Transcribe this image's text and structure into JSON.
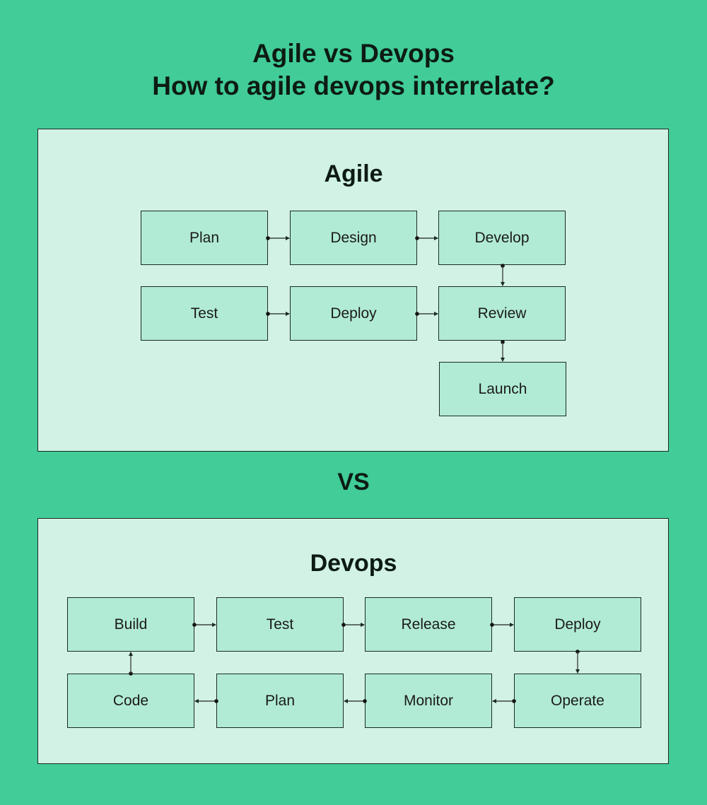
{
  "header": {
    "line1": "Agile vs Devops",
    "line2": "How to agile devops interrelate?"
  },
  "agile": {
    "title": "Agile",
    "steps": [
      "Plan",
      "Design",
      "Develop",
      "Test",
      "Deploy",
      "Review",
      "Launch"
    ],
    "flow": [
      [
        "Plan",
        "Design"
      ],
      [
        "Design",
        "Develop"
      ],
      [
        "Develop",
        "Review"
      ],
      [
        "Test",
        "Deploy"
      ],
      [
        "Deploy",
        "Review"
      ],
      [
        "Review",
        "Launch"
      ]
    ]
  },
  "vs_label": "VS",
  "devops": {
    "title": "Devops",
    "steps": [
      "Build",
      "Test",
      "Release",
      "Deploy",
      "Code",
      "Plan",
      "Monitor",
      "Operate"
    ],
    "flow": [
      [
        "Code",
        "Build"
      ],
      [
        "Build",
        "Test"
      ],
      [
        "Test",
        "Release"
      ],
      [
        "Release",
        "Deploy"
      ],
      [
        "Deploy",
        "Operate"
      ],
      [
        "Operate",
        "Monitor"
      ],
      [
        "Monitor",
        "Plan"
      ],
      [
        "Plan",
        "Code"
      ]
    ]
  },
  "colors": {
    "background": "#41cc98",
    "panel": "#d1f2e4",
    "box": "#b1ebd5",
    "border": "#1b2a22"
  }
}
